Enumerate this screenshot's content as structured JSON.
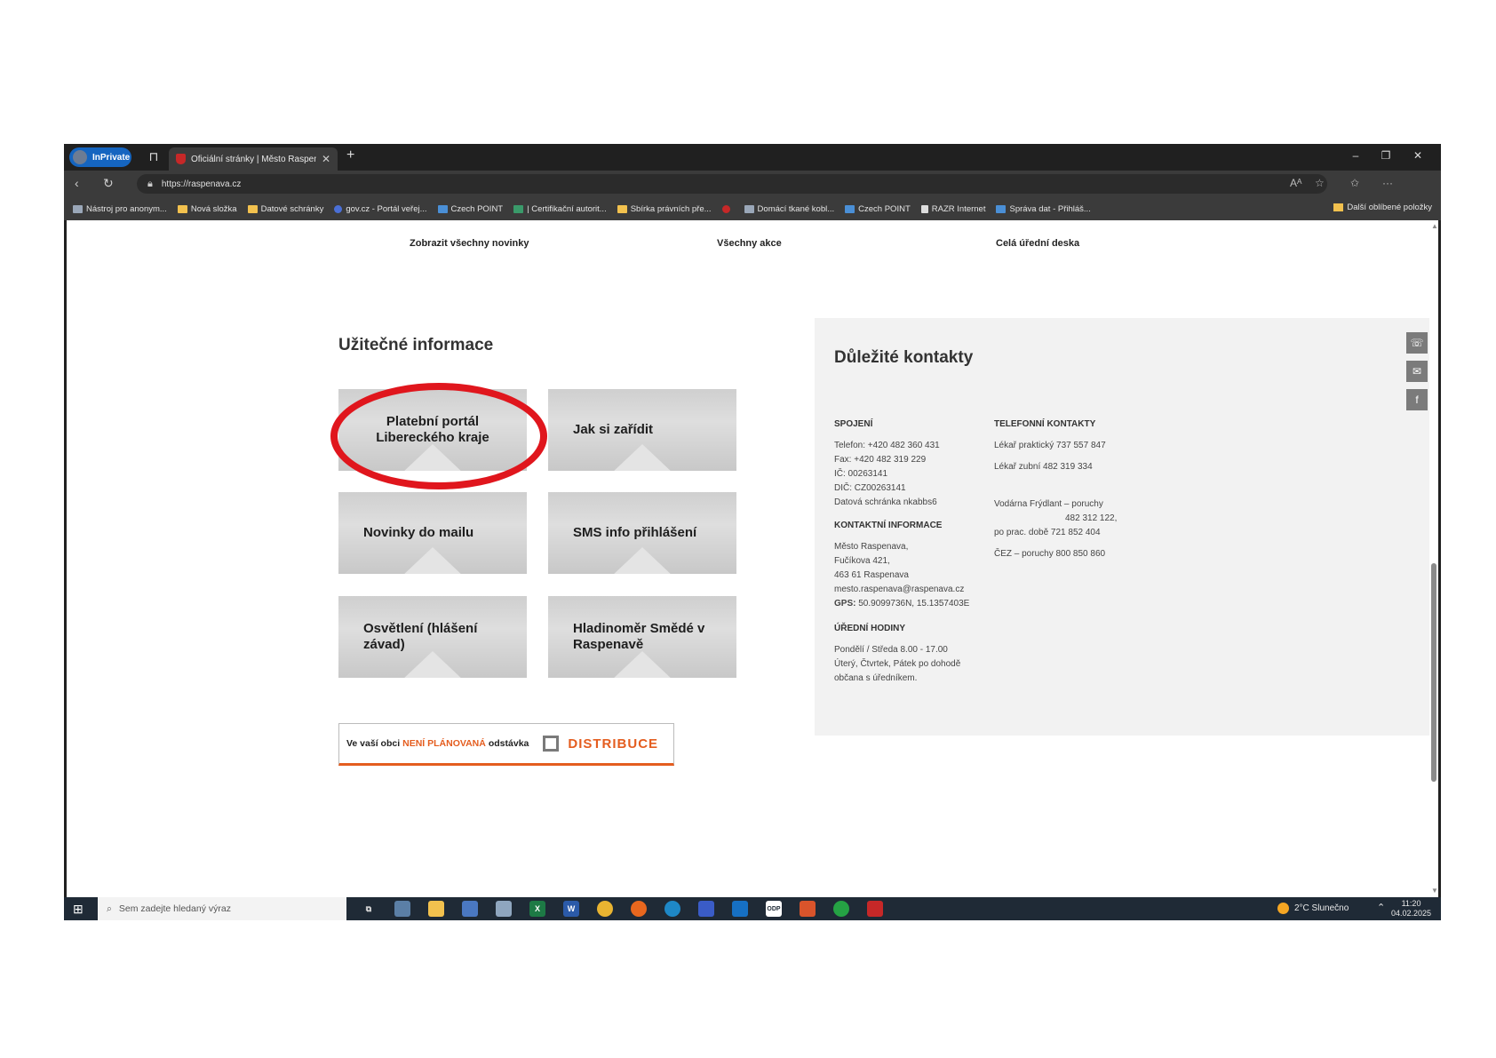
{
  "browser": {
    "inprivate_label": "InPrivate",
    "tab_title": "Oficiální stránky | Město Raspena",
    "url": "https://raspenava.cz",
    "bookmarks": [
      {
        "label": "Nástroj pro anonym...",
        "color": "#9aa7b8"
      },
      {
        "label": "Nová složka",
        "color": "#f2c14e"
      },
      {
        "label": "Datové schránky",
        "color": "#f2c14e"
      },
      {
        "label": "gov.cz - Portál veřej...",
        "color": "#4a6fd6"
      },
      {
        "label": "Czech POINT",
        "color": "#4a8fd6"
      },
      {
        "label": "| Certifikační autorit...",
        "color": "#3a9a6a"
      },
      {
        "label": "Sbírka právních pře...",
        "color": "#f2c14e"
      },
      {
        "label": "",
        "color": "#c62828"
      },
      {
        "label": "Domácí tkané kobl...",
        "color": "#9aa7b8"
      },
      {
        "label": "Czech POINT",
        "color": "#4a8fd6"
      },
      {
        "label": "RAZR Internet",
        "color": "#dddddd"
      },
      {
        "label": "Správa dat - Přihláš...",
        "color": "#4a8fd6"
      }
    ],
    "other_bookmarks": "Další oblíbené položky"
  },
  "page": {
    "top_links": [
      "Zobrazit všechny novinky",
      "Všechny akce",
      "Celá úřední deska"
    ],
    "useful_title": "Užitečné informace",
    "tiles": [
      "Platební portál Libereckého kraje",
      "Jak si zařídit",
      "Novinky do mailu",
      "SMS info přihlášení",
      "Osvětlení (hlášení závad)",
      "Hladinoměr Smědé v Raspenavě"
    ],
    "distribuce": {
      "prefix": "Ve vaší obci",
      "highlight": "NENÍ PLÁNOVANÁ",
      "suffix": "odstávka",
      "brand": "DISTRIBUCE"
    },
    "contacts": {
      "title": "Důležité kontakty",
      "spojeni_head": "SPOJENÍ",
      "spojeni": [
        "Telefon: +420 482 360 431",
        "Fax: +420 482 319 229",
        "IČ: 00263141",
        "DIČ: CZ00263141",
        "Datová schránka nkabbs6"
      ],
      "kontaktni_head": "KONTAKTNÍ INFORMACE",
      "kontaktni": [
        "Město Raspenava,",
        "Fučíkova 421,",
        "463 61 Raspenava",
        "mesto.raspenava@raspenava.cz"
      ],
      "gps_label": "GPS:",
      "gps_value": "50.9099736N, 15.1357403E",
      "hodiny_head": "ÚŘEDNÍ HODINY",
      "hodiny": [
        "Pondělí / Středa 8.00 - 17.00",
        "Úterý, Čtvrtek, Pátek po dohodě",
        "občana s úředníkem."
      ],
      "telefonni_head": "TELEFONNÍ KONTAKTY",
      "telefonni": [
        "Lékař praktický  737 557 847",
        "Lékař zubní       482 319 334",
        "Vodárna Frýdlant – poruchy",
        "482 312 122,",
        "po prac. době   721 852 404",
        "ČEZ – poruchy  800 850 860"
      ]
    }
  },
  "taskbar": {
    "search_placeholder": "Sem zadejte hledaný výraz",
    "weather": "2°C  Slunečno",
    "time": "11:20",
    "date": "04.02.2025"
  }
}
